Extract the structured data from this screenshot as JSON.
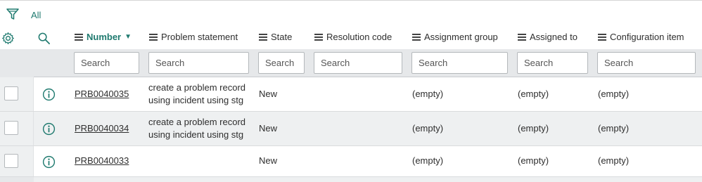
{
  "filter": {
    "label": "All"
  },
  "columns": [
    {
      "key": "number",
      "label": "Number"
    },
    {
      "key": "problem_statement",
      "label": "Problem statement"
    },
    {
      "key": "state",
      "label": "State"
    },
    {
      "key": "resolution_code",
      "label": "Resolution code"
    },
    {
      "key": "assignment_group",
      "label": "Assignment group"
    },
    {
      "key": "assigned_to",
      "label": "Assigned to"
    },
    {
      "key": "configuration_item",
      "label": "Configuration item"
    }
  ],
  "search": {
    "placeholder": "Search"
  },
  "rows": [
    {
      "number": "PRB0040035",
      "problem_statement": "create a problem record using incident using stg",
      "state": "New",
      "resolution_code": "",
      "assignment_group": "(empty)",
      "assigned_to": "(empty)",
      "configuration_item": "(empty)"
    },
    {
      "number": "PRB0040034",
      "problem_statement": "create a problem record using incident using stg",
      "state": "New",
      "resolution_code": "",
      "assignment_group": "(empty)",
      "assigned_to": "(empty)",
      "configuration_item": "(empty)"
    },
    {
      "number": "PRB0040033",
      "problem_statement": "",
      "state": "New",
      "resolution_code": "",
      "assignment_group": "(empty)",
      "assigned_to": "(empty)",
      "configuration_item": "(empty)"
    }
  ],
  "colors": {
    "accent": "#1f7a6f",
    "row_alt": "#eef0f1",
    "search_bg": "#e6e8ea"
  },
  "icons": {
    "filter": "funnel-icon",
    "settings": "gear-icon",
    "search": "search-icon",
    "column_menu": "hamburger-menu-icon",
    "sort": "sort-descending-icon",
    "info": "info-icon"
  }
}
